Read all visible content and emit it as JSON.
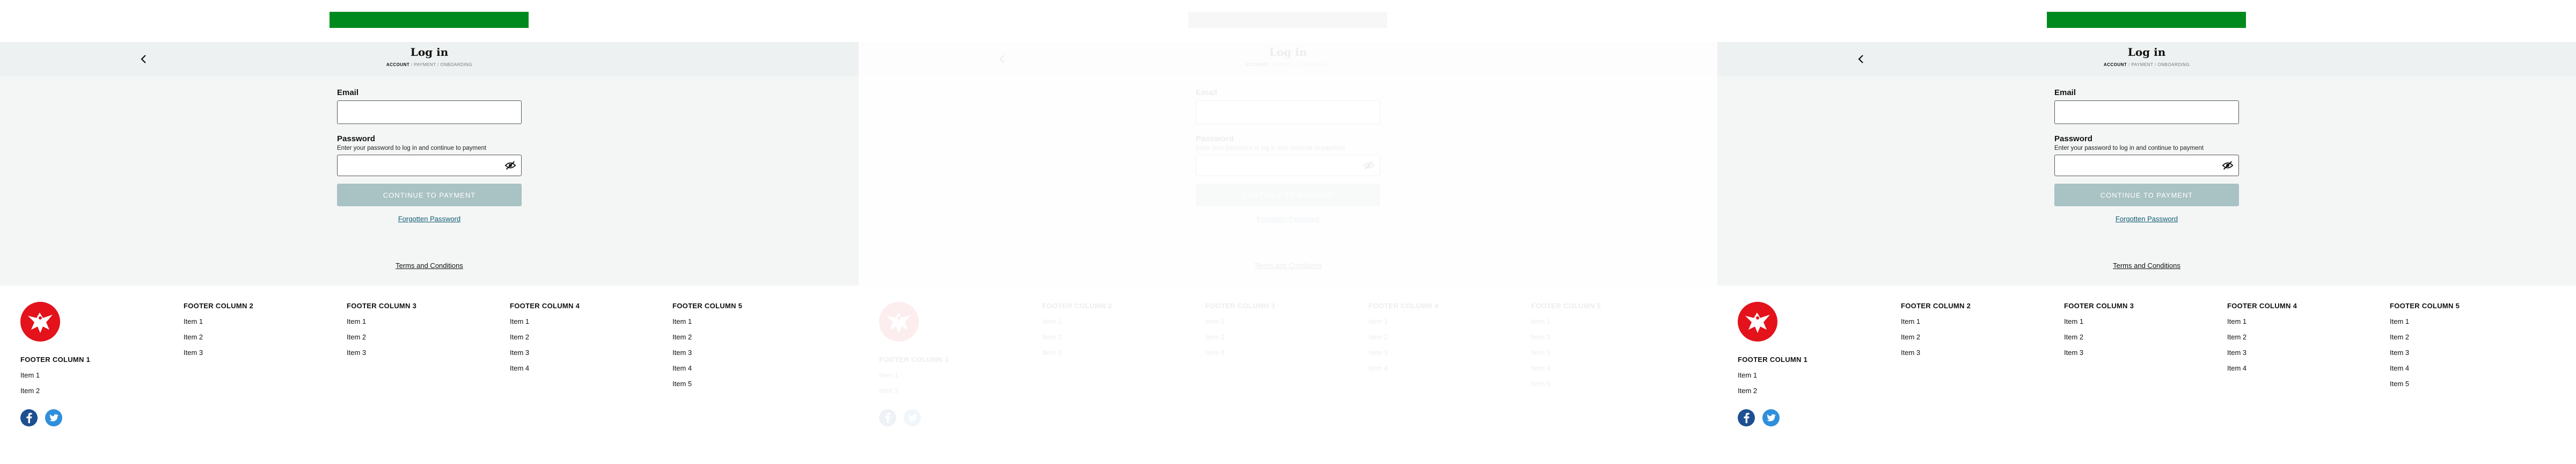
{
  "header": {
    "title": "Log in",
    "steps": [
      "ACCOUNT",
      "PAYMENT",
      "ONBOARDING"
    ],
    "step_separator": " / "
  },
  "form": {
    "email_label": "Email",
    "email_value": "",
    "password_label": "Password",
    "password_hint": "Enter your password to log in and continue to payment",
    "password_value": "",
    "continue_label": "CONTINUE TO PAYMENT",
    "forgot_label": "Forgotten Password",
    "terms_label": "Terms and Conditions"
  },
  "footer": {
    "columns": [
      {
        "title": "FOOTER COLUMN 1",
        "items": [
          "Item 1",
          "Item 2"
        ]
      },
      {
        "title": "FOOTER COLUMN 2",
        "items": [
          "Item 1",
          "Item 2",
          "Item 3"
        ]
      },
      {
        "title": "FOOTER COLUMN 3",
        "items": [
          "Item 1",
          "Item 2",
          "Item 3"
        ]
      },
      {
        "title": "FOOTER COLUMN 4",
        "items": [
          "Item 1",
          "Item 2",
          "Item 3",
          "Item 4"
        ]
      },
      {
        "title": "FOOTER COLUMN 5",
        "items": [
          "Item 1",
          "Item 2",
          "Item 3",
          "Item 4",
          "Item 5"
        ]
      }
    ],
    "social": [
      "facebook-icon",
      "twitter-icon"
    ]
  },
  "colors": {
    "banner_green": "#008a1e",
    "button_disabled": "#a9c2c4",
    "link_teal": "#0f5c70",
    "logo_red": "#e3121b",
    "facebook_blue": "#1d4f91",
    "twitter_blue": "#2f8fdc"
  }
}
